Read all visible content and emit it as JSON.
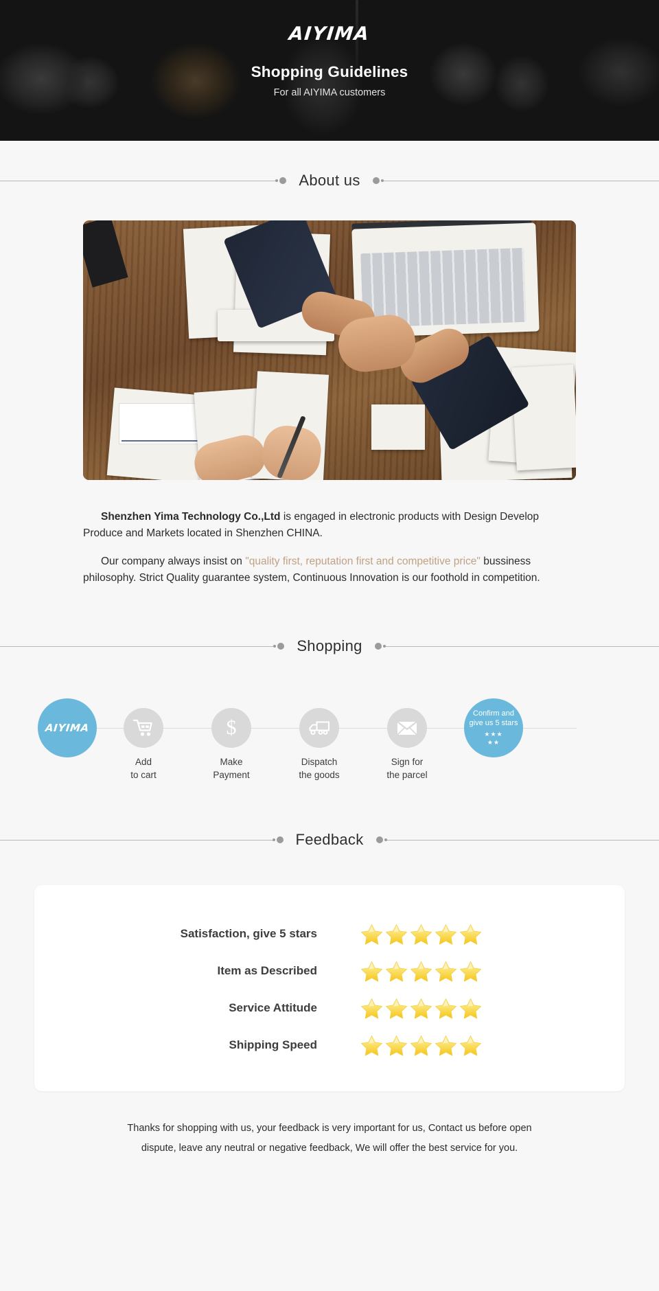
{
  "banner": {
    "logo": "AIYIMA",
    "title": "Shopping Guidelines",
    "subtitle": "For all AIYIMA customers"
  },
  "sections": {
    "about_title": "About us",
    "shopping_title": "Shopping",
    "feedback_title": "Feedback"
  },
  "about": {
    "p1_strong": "Shenzhen Yima Technology Co.,Ltd",
    "p1_rest": " is engaged in electronic products with Design Develop Produce and Markets located in Shenzhen CHINA.",
    "p2_before": "Our company always insist on ",
    "p2_quote": "\"quality first, reputation first and competitive price\"",
    "p2_after": " bussiness philosophy. Strict Quality guarantee system, Continuous Innovation is our foothold in competition."
  },
  "shopping": {
    "steps": [
      {
        "icon": "aiyima-logo-icon",
        "brand": "AIYIMA",
        "label": ""
      },
      {
        "icon": "shopping-cart-icon",
        "label": "Add\nto cart"
      },
      {
        "icon": "dollar-sign-icon",
        "glyph": "$",
        "label": "Make\nPayment"
      },
      {
        "icon": "delivery-truck-icon",
        "label": "Dispatch\nthe goods"
      },
      {
        "icon": "envelope-icon",
        "label": "Sign for\nthe parcel"
      },
      {
        "icon": "five-stars-icon",
        "line1": "Confirm and",
        "line2": "give us 5 stars",
        "stars_row1": "★★★",
        "stars_row2": "★★",
        "label": ""
      }
    ]
  },
  "feedback": {
    "rows": [
      {
        "label": "Satisfaction, give 5 stars",
        "stars": 5
      },
      {
        "label": "Item as Described",
        "stars": 5
      },
      {
        "label": "Service Attitude",
        "stars": 5
      },
      {
        "label": "Shipping Speed",
        "stars": 5
      }
    ],
    "note_line1": "Thanks for shopping with us, your feedback is very important for us, Contact us before open",
    "note_line2": "dispute, leave any neutral or negative feedback, We will offer the best service for you."
  },
  "colors": {
    "brand_blue": "#6ab9dd",
    "banner_bg": "#141414",
    "page_bg": "#f7f7f7",
    "quote_tan": "#c0a284",
    "star_yellow": "#f9d949"
  }
}
